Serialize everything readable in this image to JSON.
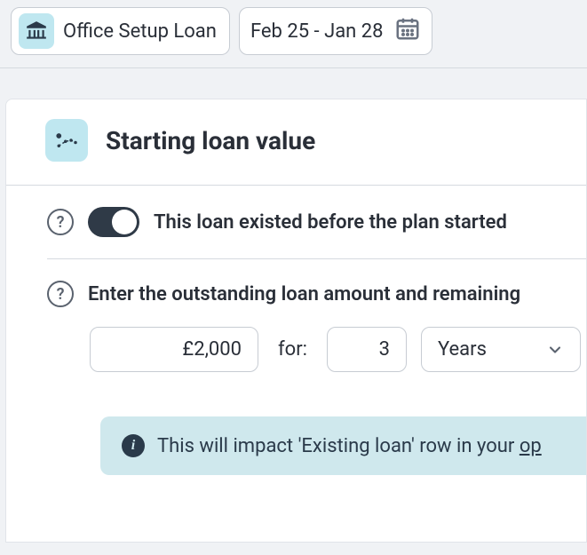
{
  "topbar": {
    "loan_name": "Office Setup Loan",
    "date_range": "Feb 25 - Jan 28"
  },
  "card": {
    "title": "Starting loan value",
    "toggle_label": "This loan existed before the plan started",
    "prompt": "Enter the outstanding loan amount and remaining",
    "amount": "£2,000",
    "for_label": "for:",
    "duration": "3",
    "unit_selected": "Years",
    "info_prefix": "This will impact 'Existing loan' row in your ",
    "info_link": "op"
  }
}
